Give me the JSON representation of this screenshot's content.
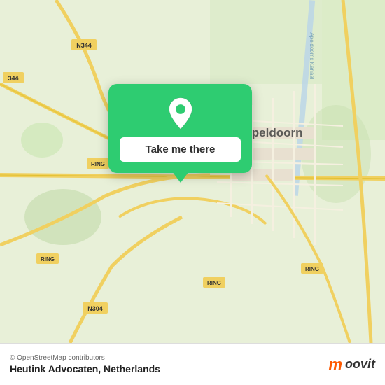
{
  "map": {
    "background_color": "#e8f0d8",
    "attribution": "© OpenStreetMap contributors"
  },
  "popup": {
    "button_label": "Take me there",
    "pin_color": "#ffffff"
  },
  "footer": {
    "copyright": "© OpenStreetMap contributors",
    "location": "Heutink Advocaten, Netherlands",
    "logo_m": "m",
    "logo_text": "oovit"
  },
  "road_labels": [
    "344",
    "N344",
    "RING",
    "N304",
    "RING",
    "RING",
    "RING",
    "RING"
  ],
  "city_label": "Apeldoorn"
}
